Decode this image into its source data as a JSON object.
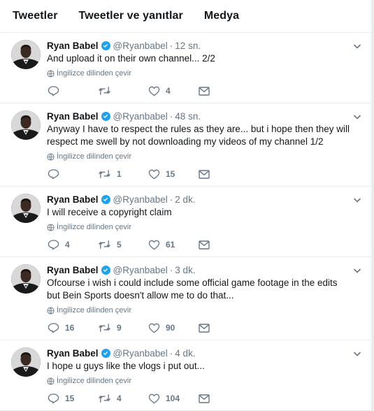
{
  "tabs": [
    "Tweetler",
    "Tweetler ve yanıtlar",
    "Medya"
  ],
  "colors": {
    "verified": "#1da1f2",
    "meta": "#657786",
    "text": "#14171a",
    "divider": "#e6ecf0"
  },
  "tweets": [
    {
      "name": "Ryan Babel",
      "handle": "@Ryanbabel",
      "sep": "·",
      "time": "12 sn.",
      "text": "And upload it on their own channel... 2/2",
      "translate": "İngilizce dilinden çevir",
      "replies": "",
      "retweets": "",
      "likes": "4"
    },
    {
      "name": "Ryan Babel",
      "handle": "@Ryanbabel",
      "sep": "·",
      "time": "48 sn.",
      "text": "Anyway I have to respect the rules as they are... but i hope then they will respect me swell by not downloading my videos of my channel 1/2",
      "translate": "İngilizce dilinden çevir",
      "replies": "",
      "retweets": "1",
      "likes": "15"
    },
    {
      "name": "Ryan Babel",
      "handle": "@Ryanbabel",
      "sep": "·",
      "time": "2 dk.",
      "text": "I will receive a copyright claim",
      "translate": "İngilizce dilinden çevir",
      "replies": "4",
      "retweets": "5",
      "likes": "61"
    },
    {
      "name": "Ryan Babel",
      "handle": "@Ryanbabel",
      "sep": "·",
      "time": "3 dk.",
      "text": "Ofcourse i wish i could include some official game footage in the edits but Bein Sports doesn't allow me to do that...",
      "translate": "İngilizce dilinden çevir",
      "replies": "16",
      "retweets": "9",
      "likes": "90"
    },
    {
      "name": "Ryan Babel",
      "handle": "@Ryanbabel",
      "sep": "·",
      "time": "4 dk.",
      "text": "I hope u guys like the vlogs i put out...",
      "translate": "İngilizce dilinden çevir",
      "replies": "15",
      "retweets": "4",
      "likes": "104"
    }
  ]
}
